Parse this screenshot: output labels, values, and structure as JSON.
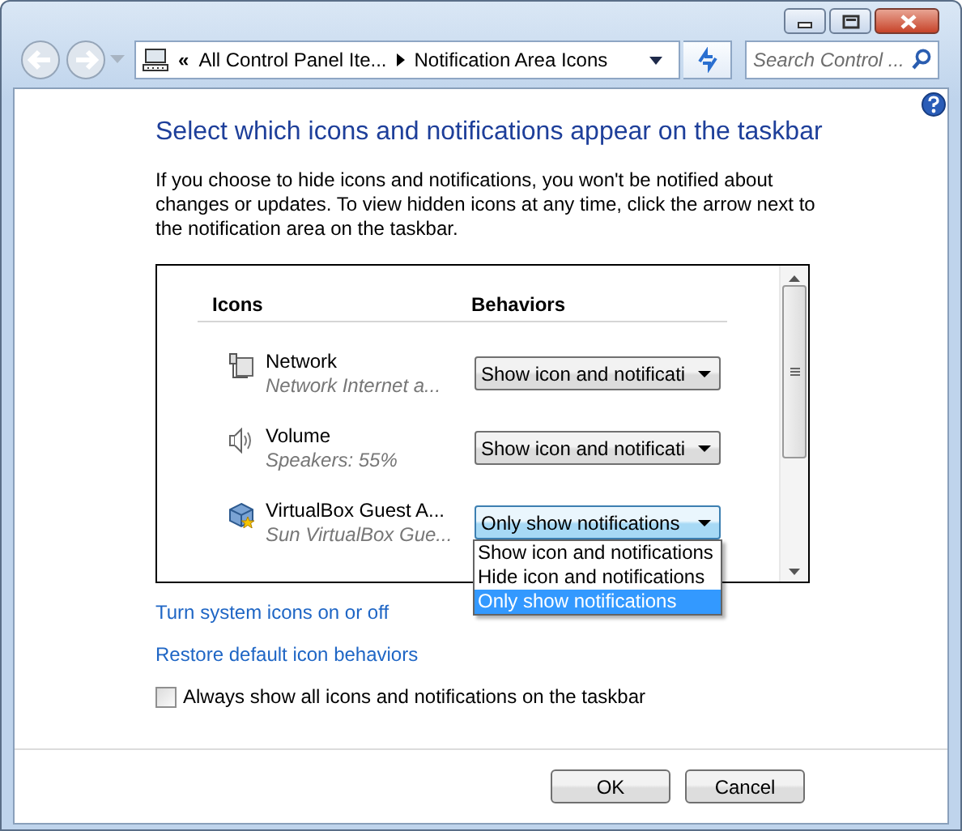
{
  "window": {
    "controls": [
      {
        "kind": "minimize"
      },
      {
        "kind": "maximize"
      },
      {
        "kind": "close"
      }
    ]
  },
  "nav": {
    "overflow": "«",
    "breadcrumb": [
      {
        "label": "All Control Panel Ite..."
      },
      {
        "label": "Notification Area Icons"
      }
    ],
    "search": {
      "placeholder": "Search Control ..."
    }
  },
  "heading": "Select which icons and notifications appear on the taskbar",
  "description": "If you choose to hide icons and notifications, you won't be notified about changes or updates. To view hidden icons at any time, click the arrow next to the notification area on the taskbar.",
  "table": {
    "columns": [
      "Icons",
      "Behaviors"
    ],
    "rows": [
      {
        "kind": "network",
        "name": "Network",
        "detail": "Network Internet a...",
        "behavior": "Show icon and notificati",
        "open": false
      },
      {
        "kind": "volume",
        "name": "Volume",
        "detail": "Speakers: 55%",
        "behavior": "Show icon and notificati",
        "open": false
      },
      {
        "kind": "app",
        "name": "VirtualBox Guest A...",
        "detail": "Sun VirtualBox Gue...",
        "behavior": "Only show notifications",
        "open": true,
        "options": [
          {
            "label": "Show icon and notifications",
            "selected": false
          },
          {
            "label": "Hide icon and notifications",
            "selected": false
          },
          {
            "label": "Only show notifications",
            "selected": true
          }
        ]
      }
    ]
  },
  "links": [
    "Turn system icons on or off",
    "Restore default icon behaviors"
  ],
  "always_show": {
    "label": "Always show all icons and notifications on the taskbar",
    "checked": false
  },
  "buttons": [
    "OK",
    "Cancel"
  ]
}
